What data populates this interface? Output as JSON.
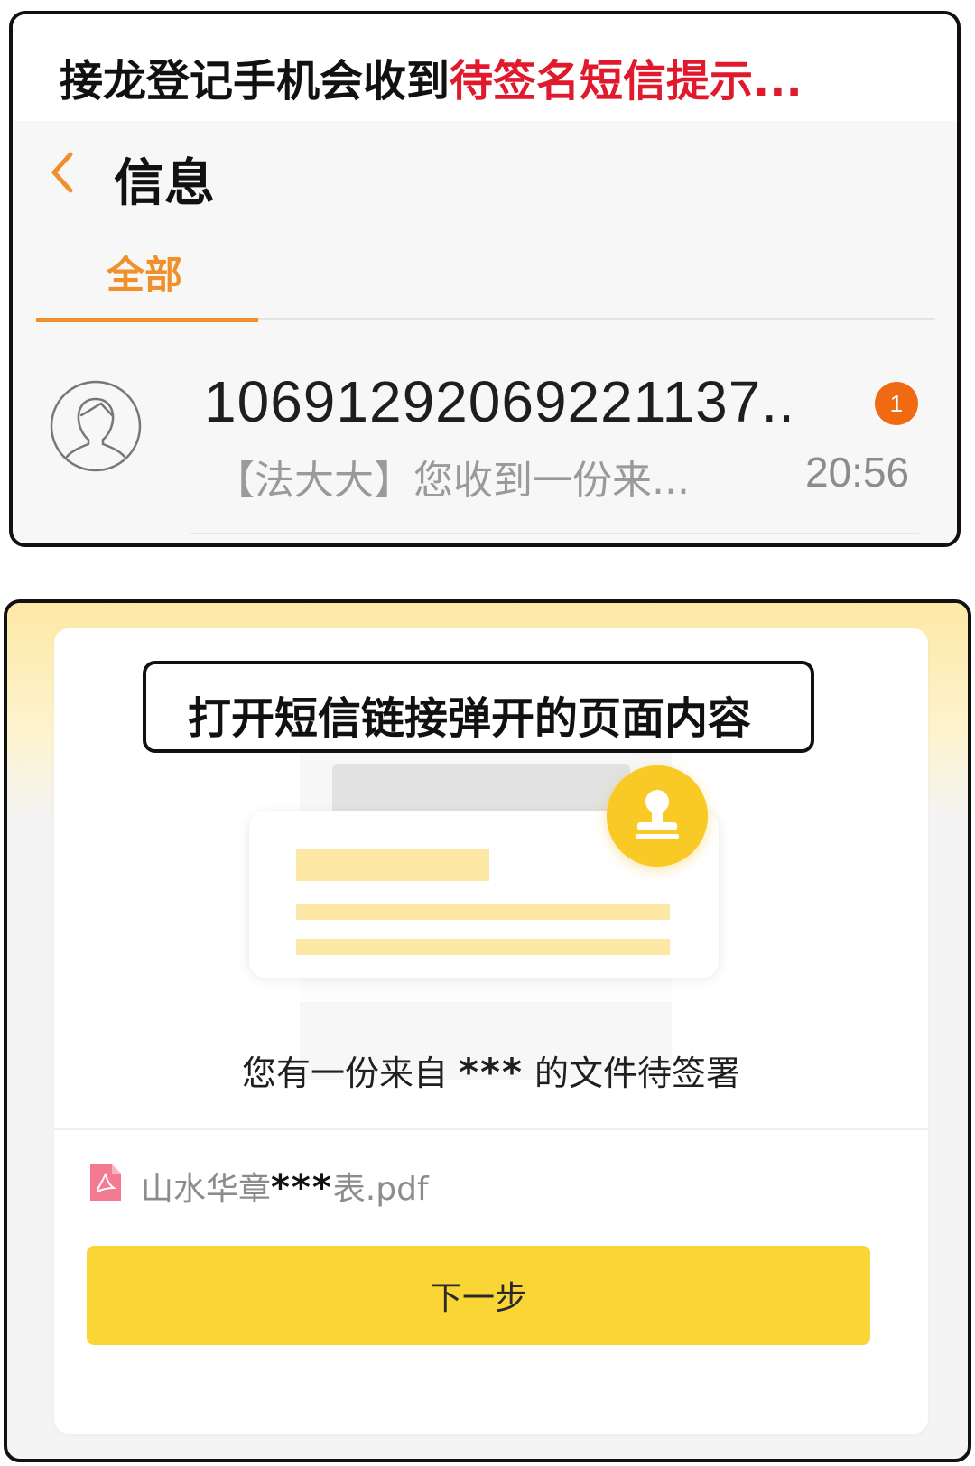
{
  "top_panel": {
    "caption_prefix": "接龙登记手机会收到",
    "caption_highlight": "待签名短信提示...",
    "header": {
      "title": "信息"
    },
    "tabs": [
      {
        "label": "全部"
      }
    ],
    "message": {
      "sender": "10691292069221137..",
      "preview": "【法大大】您收到一份来...",
      "time": "20:56",
      "unread_count": "1"
    }
  },
  "bottom_panel": {
    "caption": "打开短信链接弹开的页面内容",
    "pending": {
      "prefix": "您有一份来自",
      "masked": "***",
      "suffix": "的文件待签署"
    },
    "file": {
      "name_prefix": "山水华章",
      "name_masked": "***",
      "name_suffix": "表.pdf"
    },
    "next_button_label": "下一步"
  },
  "colors": {
    "accent_orange": "#f0902a",
    "badge_orange": "#f06a14",
    "highlight_red": "#e0192c",
    "button_yellow": "#f9d536",
    "stamp_yellow": "#f9c925",
    "doc_line_yellow": "#fde7a4"
  },
  "icons": {
    "back": "chevron-left-icon",
    "avatar": "person-avatar-icon",
    "stamp": "seal-stamp-icon",
    "pdf": "pdf-file-icon"
  }
}
